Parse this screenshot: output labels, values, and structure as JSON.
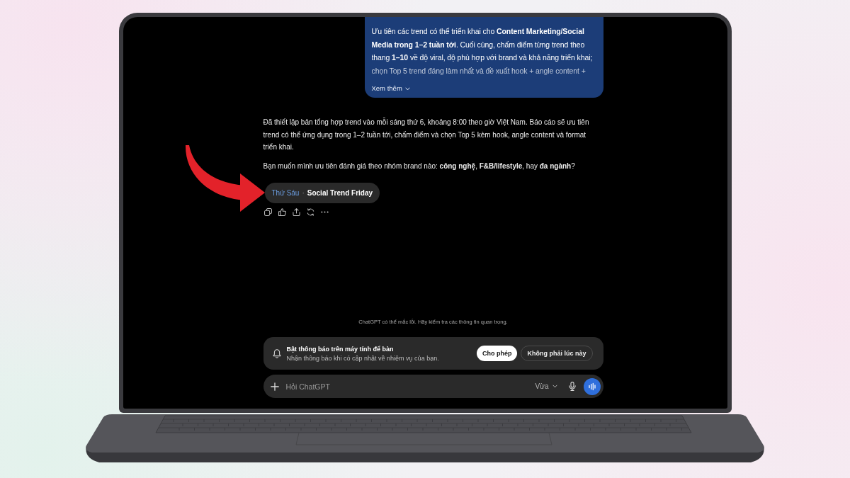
{
  "user_message": {
    "expanded": false,
    "lines": [
      "Ưu tiên các trend có thể triển khai cho **Content Marketing/Social**",
      "**Media trong 1–2 tuần tới**. Cuối cùng, chấm điểm từng trend theo",
      "thang **1–10** về độ viral, độ phù hợp với brand và khả năng triển khai;",
      "chọn Top 5 trend đáng làm nhất và đề xuất hook + angle content +"
    ],
    "show_more": "Xem thêm"
  },
  "assistant_message": {
    "paragraphs": [
      {
        "lines": [
          "Đã thiết lập bản tổng hợp trend vào mỗi sáng thứ 6, khoảng 8:00 theo giờ Việt Nam. Báo cáo sẽ ưu tiên",
          "trend có thể ứng dụng trong 1–2 tuần tới, chấm điểm và chọn Top 5 kèm hook, angle content và format",
          "triển khai."
        ]
      },
      {
        "lines": [
          "Bạn muốn mình ưu tiên đánh giá theo nhóm brand nào: **công nghệ**, **F&B/lifestyle**, hay **đa ngành**?"
        ]
      }
    ]
  },
  "task_chip": {
    "day": "Thứ Sáu",
    "separator": "·",
    "title": "Social Trend Friday"
  },
  "disclaimer": "ChatGPT có thể mắc lỗi. Hãy kiểm tra các thông tin quan trọng.",
  "notification_prompt": {
    "title": "Bật thông báo trên máy tính để bàn",
    "subtitle": "Nhận thông báo khi có cập nhật về nhiệm vụ của bạn.",
    "buttons": [
      {
        "label": "Cho phép",
        "kind": "primary"
      },
      {
        "label": "Không phải lúc này",
        "kind": "secondary"
      }
    ]
  },
  "composer": {
    "placeholder": "Hỏi ChatGPT",
    "model": "Vừa"
  }
}
